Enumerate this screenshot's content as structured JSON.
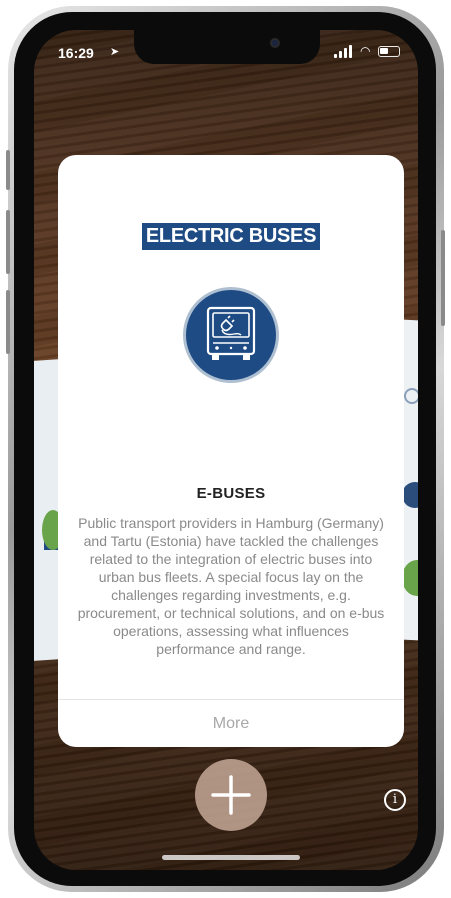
{
  "status_bar": {
    "time": "16:29",
    "location_glyph": "➤",
    "wifi_glyph": "◠"
  },
  "card": {
    "banner_title": "ELECTRIC BUSES",
    "icon": "electric-bus-plug-icon",
    "heading": "E-BUSES",
    "body": "Public transport providers in Hamburg (Germany) and Tartu (Estonia) have tackled the challenges related to the integration of electric buses into urban bus fleets. A special focus lay on the challenges regarding investments, e.g. procurement, or technical solutions, and on e-bus operations, assessing what influences performance and range.",
    "more_label": "More"
  },
  "controls": {
    "add_icon": "plus-icon",
    "info_label": "i"
  },
  "colors": {
    "brand_blue": "#1f4b84",
    "add_button": "#c6a896",
    "muted_text": "#8a8a8a"
  }
}
